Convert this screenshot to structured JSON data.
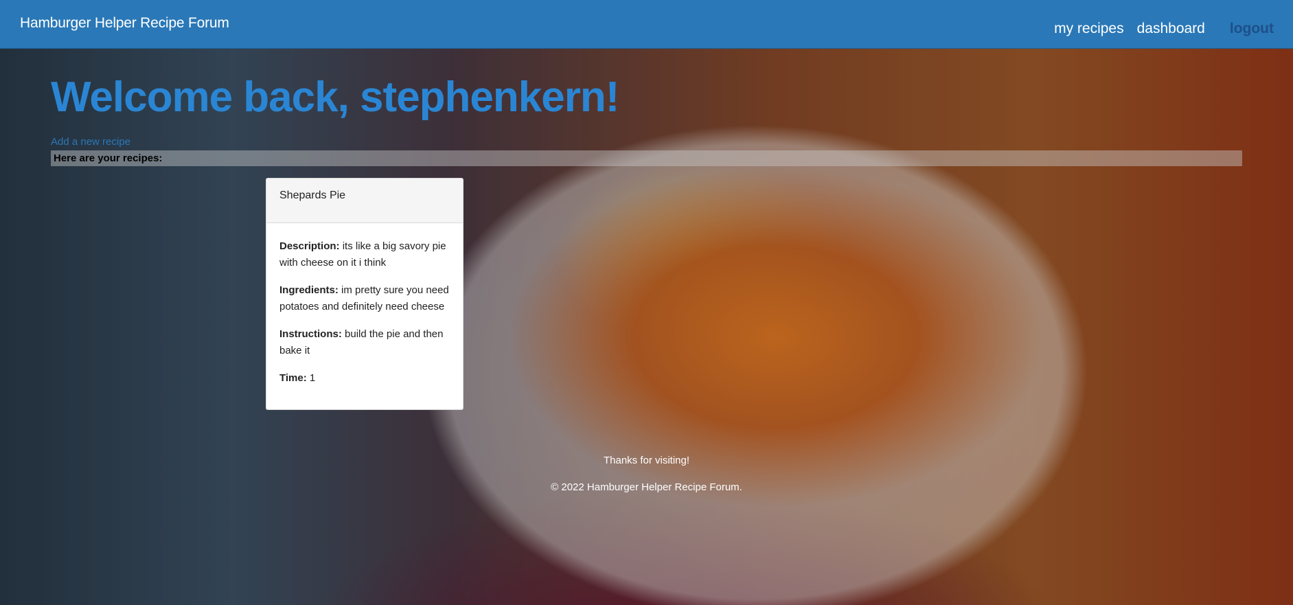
{
  "navbar": {
    "brand": "Hamburger Helper Recipe Forum",
    "links": {
      "my_recipes": "my recipes",
      "dashboard": "dashboard",
      "logout": "logout"
    }
  },
  "main": {
    "welcome": "Welcome back, stephenkern!",
    "add_recipe_link": "Add a new recipe",
    "recipes_heading": "Here are your recipes:",
    "recipes": [
      {
        "title": "Shepards Pie",
        "description_label": "Description:",
        "description": "its like a big savory pie with cheese on it i think",
        "ingredients_label": "Ingredients:",
        "ingredients": "im pretty sure you need potatoes and definitely need cheese",
        "instructions_label": "Instructions:",
        "instructions": "build the pie and then bake it",
        "time_label": "Time:",
        "time": "1"
      }
    ]
  },
  "footer": {
    "thanks": "Thanks for visiting!",
    "copyright": "© 2022 Hamburger Helper Recipe Forum."
  },
  "colors": {
    "navbar": "#2a78b7",
    "welcome_heading": "#2a86d4",
    "logout": "#1e4f8a"
  }
}
